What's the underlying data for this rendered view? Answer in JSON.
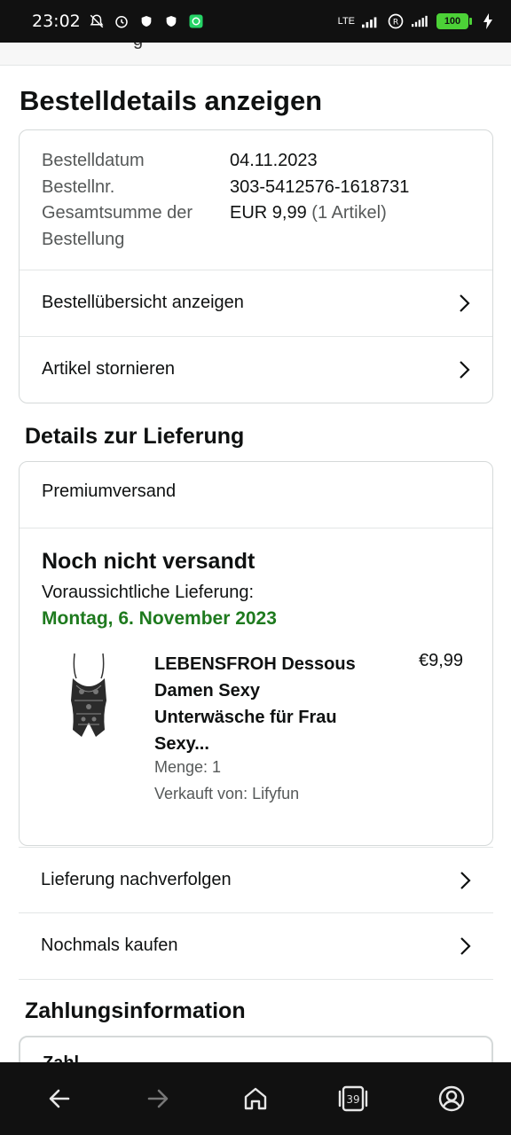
{
  "status_bar": {
    "time": "23:02",
    "network": "LTE",
    "roaming": "R",
    "battery": "100"
  },
  "top_strip": {
    "partial_text": "g"
  },
  "page": {
    "title": "Bestelldetails anzeigen"
  },
  "order_summary": {
    "rows": [
      {
        "label": "Bestelldatum",
        "value": "04.11.2023",
        "value_note": ""
      },
      {
        "label": "Bestellnr.",
        "value": "303-5412576-1618731",
        "value_note": ""
      },
      {
        "label": "Gesamtsumme der Bestellung",
        "value": "EUR 9,99",
        "value_note": "(1 Artikel)"
      }
    ],
    "links": [
      {
        "label": "Bestellübersicht anzeigen"
      },
      {
        "label": "Artikel stornieren"
      }
    ]
  },
  "delivery": {
    "section_title": "Details zur Lieferung",
    "shipping_method": "Premiumversand",
    "status": "Noch nicht versandt",
    "eta_label": "Voraussichtliche Lieferung:",
    "eta_date": "Montag, 6. November 2023",
    "eta_color": "#1e7a1e",
    "product": {
      "title": "LEBENSFROH Dessous Damen Sexy Unterwäsche für Frau Sexy...",
      "price": "€9,99",
      "quantity": "Menge: 1",
      "seller": "Verkauft von: Lifyfun"
    },
    "actions": [
      {
        "label": "Lieferung nachverfolgen"
      },
      {
        "label": "Nochmals kaufen"
      }
    ]
  },
  "payment": {
    "section_title": "Zahlungsinformation",
    "stub_text": "Zahl"
  },
  "bottom_nav": {
    "tabs_count": "39",
    "icons": [
      "back-arrow-icon",
      "forward-arrow-icon",
      "home-icon",
      "tabs-icon",
      "account-icon"
    ]
  }
}
